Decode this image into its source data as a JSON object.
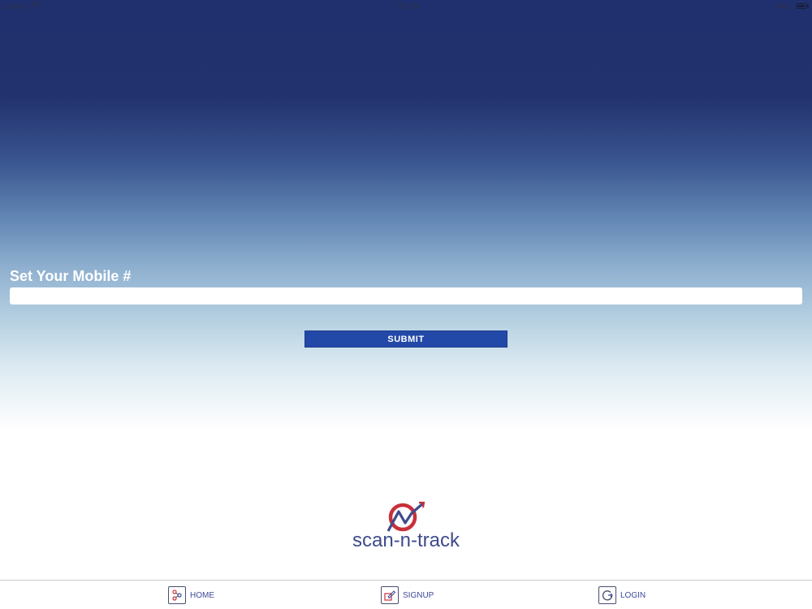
{
  "status_bar": {
    "carrier": "Carrier",
    "time": "7:20 PM",
    "battery": "84%"
  },
  "form": {
    "label": "Set Your Mobile #",
    "input_value": "",
    "input_placeholder": "",
    "submit_label": "SUBMIT"
  },
  "logo": {
    "text": "scan-n-track"
  },
  "tabs": [
    {
      "label": "HOME",
      "icon": "home-icon"
    },
    {
      "label": "SIGNUP",
      "icon": "signup-icon"
    },
    {
      "label": "LOGIN",
      "icon": "login-icon"
    }
  ],
  "colors": {
    "gradient_top": "#20306e",
    "submit_button": "#2349a8",
    "logo_red": "#c8303a",
    "logo_blue": "#3f4b8c",
    "tab_label": "#3d4a9a"
  }
}
